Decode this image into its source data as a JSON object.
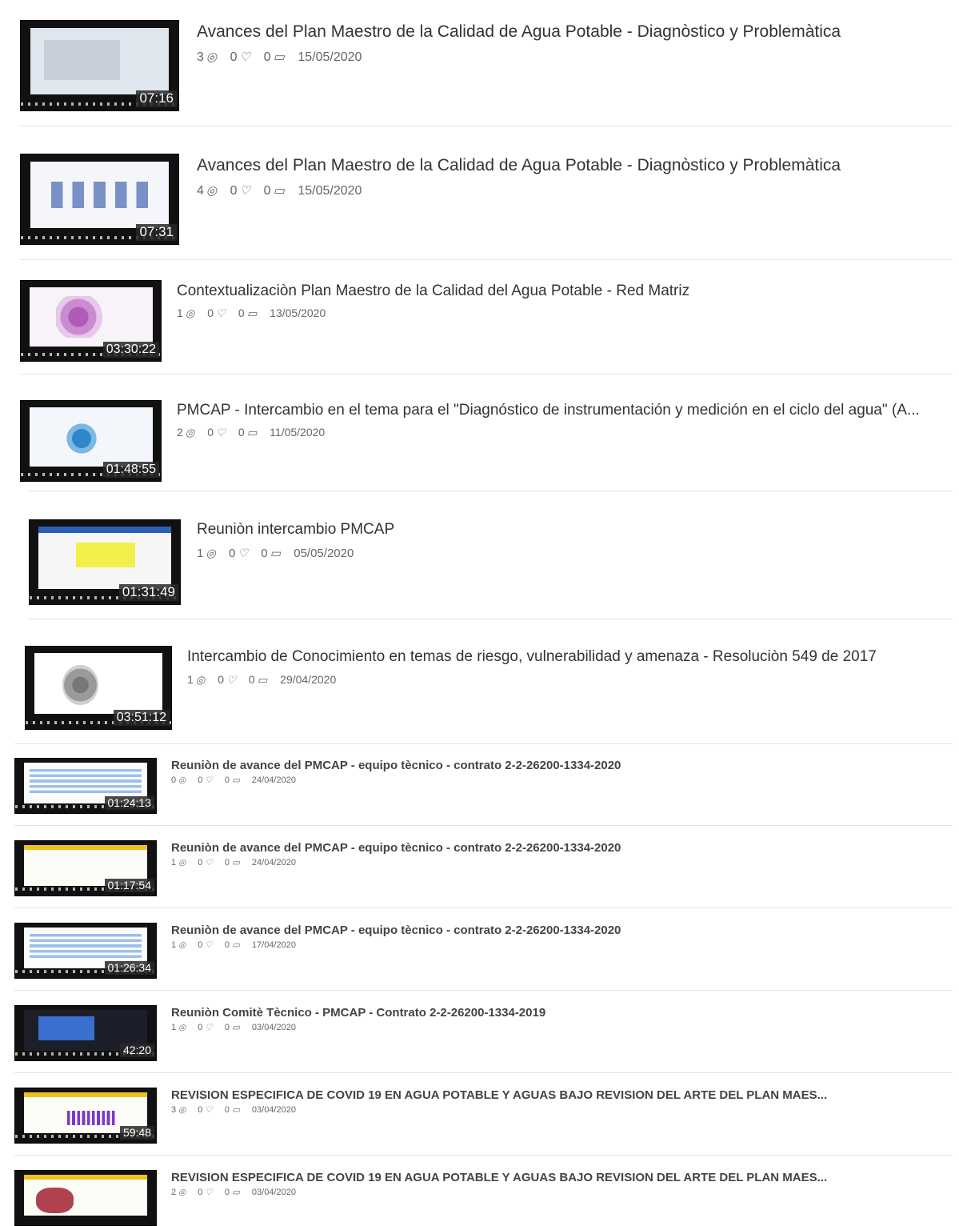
{
  "videos": [
    {
      "title": "Avances del Plan Maestro de la Calidad de Agua Potable - Diagnòstico y Problemàtica",
      "views": "3",
      "likes": "0",
      "comments": "0",
      "date": "15/05/2020",
      "duration": "07:16",
      "icon_views": "play-circle-icon",
      "icon_likes": "heart-icon",
      "icon_comments": "comment-icon"
    },
    {
      "title": "Avances del Plan Maestro de la Calidad de Agua Potable - Diagnòstico y Problemàtica",
      "views": "4",
      "likes": "0",
      "comments": "0",
      "date": "15/05/2020",
      "duration": "07:31"
    },
    {
      "title": "Contextualizaciòn Plan Maestro de la Calidad del Agua Potable - Red Matriz",
      "views": "1",
      "likes": "0",
      "comments": "0",
      "date": "13/05/2020",
      "duration": "03:30:22"
    },
    {
      "title": "PMCAP - Intercambio en el tema para el \"Diagnóstico de instrumentación y medición en el ciclo del agua\" (A...",
      "views": "2",
      "likes": "0",
      "comments": "0",
      "date": "11/05/2020",
      "duration": "01:48:55"
    },
    {
      "title": "Reuniòn intercambio PMCAP",
      "views": "1",
      "likes": "0",
      "comments": "0",
      "date": "05/05/2020",
      "duration": "01:31:49"
    },
    {
      "title": "Intercambio de Conocimiento en temas de riesgo, vulnerabilidad y amenaza - Resoluciòn 549 de 2017",
      "views": "1",
      "likes": "0",
      "comments": "0",
      "date": "29/04/2020",
      "duration": "03:51:12"
    },
    {
      "title": "Reuniòn de avance del PMCAP - equipo tècnico - contrato 2-2-26200-1334-2020",
      "views": "0",
      "likes": "0",
      "comments": "0",
      "date": "24/04/2020",
      "duration": "01:24:13"
    },
    {
      "title": "Reuniòn de avance del PMCAP - equipo tècnico - contrato 2-2-26200-1334-2020",
      "views": "1",
      "likes": "0",
      "comments": "0",
      "date": "24/04/2020",
      "duration": "01:17:54"
    },
    {
      "title": "Reuniòn de avance del PMCAP - equipo tècnico - contrato 2-2-26200-1334-2020",
      "views": "1",
      "likes": "0",
      "comments": "0",
      "date": "17/04/2020",
      "duration": "01:26:34"
    },
    {
      "title": "Reuniòn Comitè Tècnico - PMCAP - Contrato 2-2-26200-1334-2019",
      "views": "1",
      "likes": "0",
      "comments": "0",
      "date": "03/04/2020",
      "duration": "42:20"
    },
    {
      "title": "REVISION ESPECIFICA DE COVID 19 EN AGUA POTABLE Y AGUAS BAJO REVISION DEL ARTE DEL PLAN MAES...",
      "views": "3",
      "likes": "0",
      "comments": "0",
      "date": "03/04/2020",
      "duration": "59:48"
    },
    {
      "title": "REVISION ESPECIFICA DE COVID 19 EN AGUA POTABLE Y AGUAS BAJO REVISION DEL ARTE DEL PLAN MAES...",
      "views": "2",
      "likes": "0",
      "comments": "0",
      "date": "03/04/2020",
      "duration": ""
    }
  ]
}
